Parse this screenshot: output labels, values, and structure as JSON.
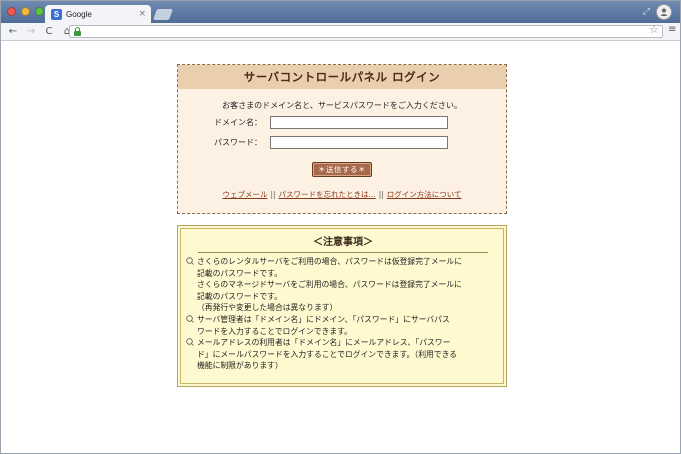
{
  "browser": {
    "tab_title": "Google",
    "favicon_letter": "S",
    "tab_close": "×",
    "nav_back": "←",
    "nav_forward": "→",
    "nav_reload": "C",
    "nav_home": "⌂",
    "star": "☆",
    "menu": "≡",
    "fullscreen": "⤢"
  },
  "login": {
    "title": "サーバコントロールパネル ログイン",
    "instructions": "お客さまのドメイン名と、サービスパスワードをご入力ください。",
    "domain_label": "ドメイン名：",
    "domain_value": "",
    "password_label": "パスワード：",
    "password_value": "",
    "submit_label": "＊送信する＊",
    "links": {
      "webmail": "ウェブメール",
      "forgot": "パスワードを忘れたときは...",
      "howto": "ログイン方法について",
      "separator": "||"
    }
  },
  "notice": {
    "title": "＜注意事項＞",
    "items": [
      {
        "lines": [
          "さくらのレンタルサーバをご利用の場合、パスワードは仮登録完了メールに",
          "記載のパスワードです。",
          "さくらのマネージドサーバをご利用の場合、パスワードは登録完了メールに",
          "記載のパスワードです。",
          "（再発行や変更した場合は異なります）"
        ]
      },
      {
        "lines": [
          "サーバ管理者は「ドメイン名」にドメイン、「パスワード」にサーバパス",
          "ワードを入力することでログインできます。"
        ]
      },
      {
        "lines": [
          "メールアドレスの利用者は「ドメイン名」にメールアドレス、「パスワー",
          "ド」にメールパスワードを入力することでログインできます。（利用できる",
          "機能に制限があります）"
        ]
      }
    ]
  },
  "colors": {
    "login_header_bg": "#e9cfae",
    "login_bg": "#fdf1e4",
    "button_bg": "#a8694a",
    "link": "#8a3a1a",
    "notice_bg": "#fff9d0"
  }
}
